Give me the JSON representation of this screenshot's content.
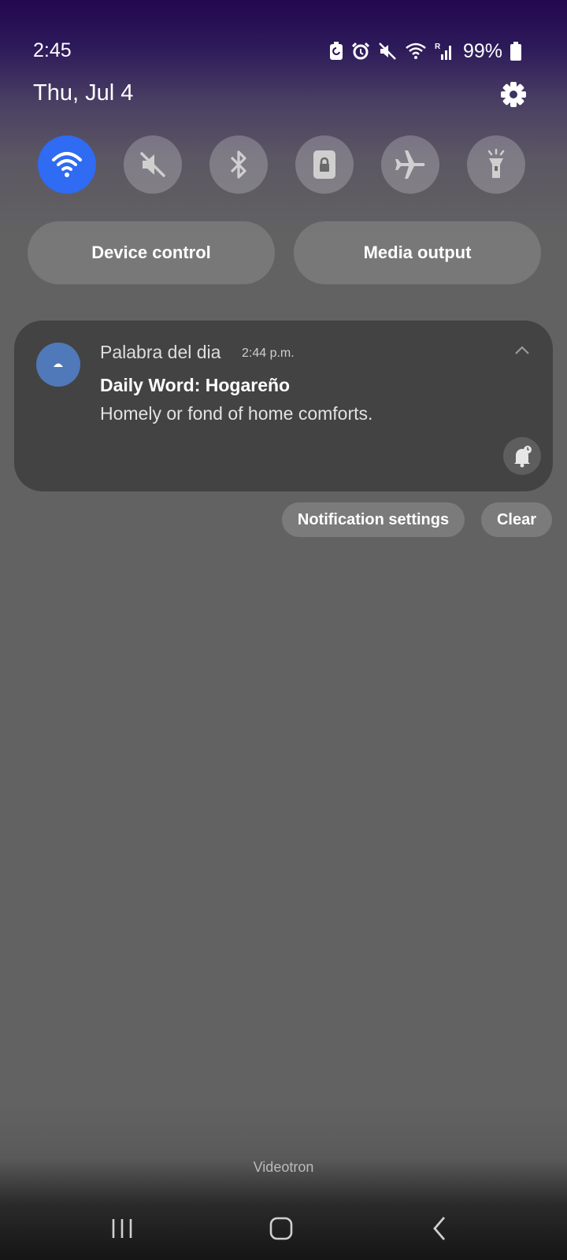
{
  "status_bar": {
    "time": "2:45",
    "battery": "99%",
    "icons": [
      "battery-saver-icon",
      "alarm-icon",
      "mute-icon",
      "wifi-icon",
      "signal-roaming-icon",
      "battery-icon"
    ]
  },
  "header": {
    "date": "Thu, Jul 4",
    "settings_icon": "gear-icon"
  },
  "quick_toggles": [
    {
      "name": "wifi",
      "icon": "wifi-icon",
      "active": true
    },
    {
      "name": "sound",
      "icon": "mute-icon",
      "active": false
    },
    {
      "name": "bluetooth",
      "icon": "bluetooth-icon",
      "active": false
    },
    {
      "name": "rotation-lock",
      "icon": "lock-icon",
      "active": false
    },
    {
      "name": "airplane",
      "icon": "airplane-icon",
      "active": false
    },
    {
      "name": "flashlight",
      "icon": "flashlight-icon",
      "active": false
    }
  ],
  "buttons": {
    "device_control": "Device control",
    "media_output": "Media output"
  },
  "notification": {
    "app_name": "Palabra del dia",
    "time": "2:44 p.m.",
    "title": "Daily Word: Hogareño",
    "text": "Homely or fond of home comforts."
  },
  "actions": {
    "settings": "Notification settings",
    "clear": "Clear"
  },
  "carrier": "Videotron",
  "colors": {
    "accent": "#2f6bf3",
    "card": "#434343"
  }
}
